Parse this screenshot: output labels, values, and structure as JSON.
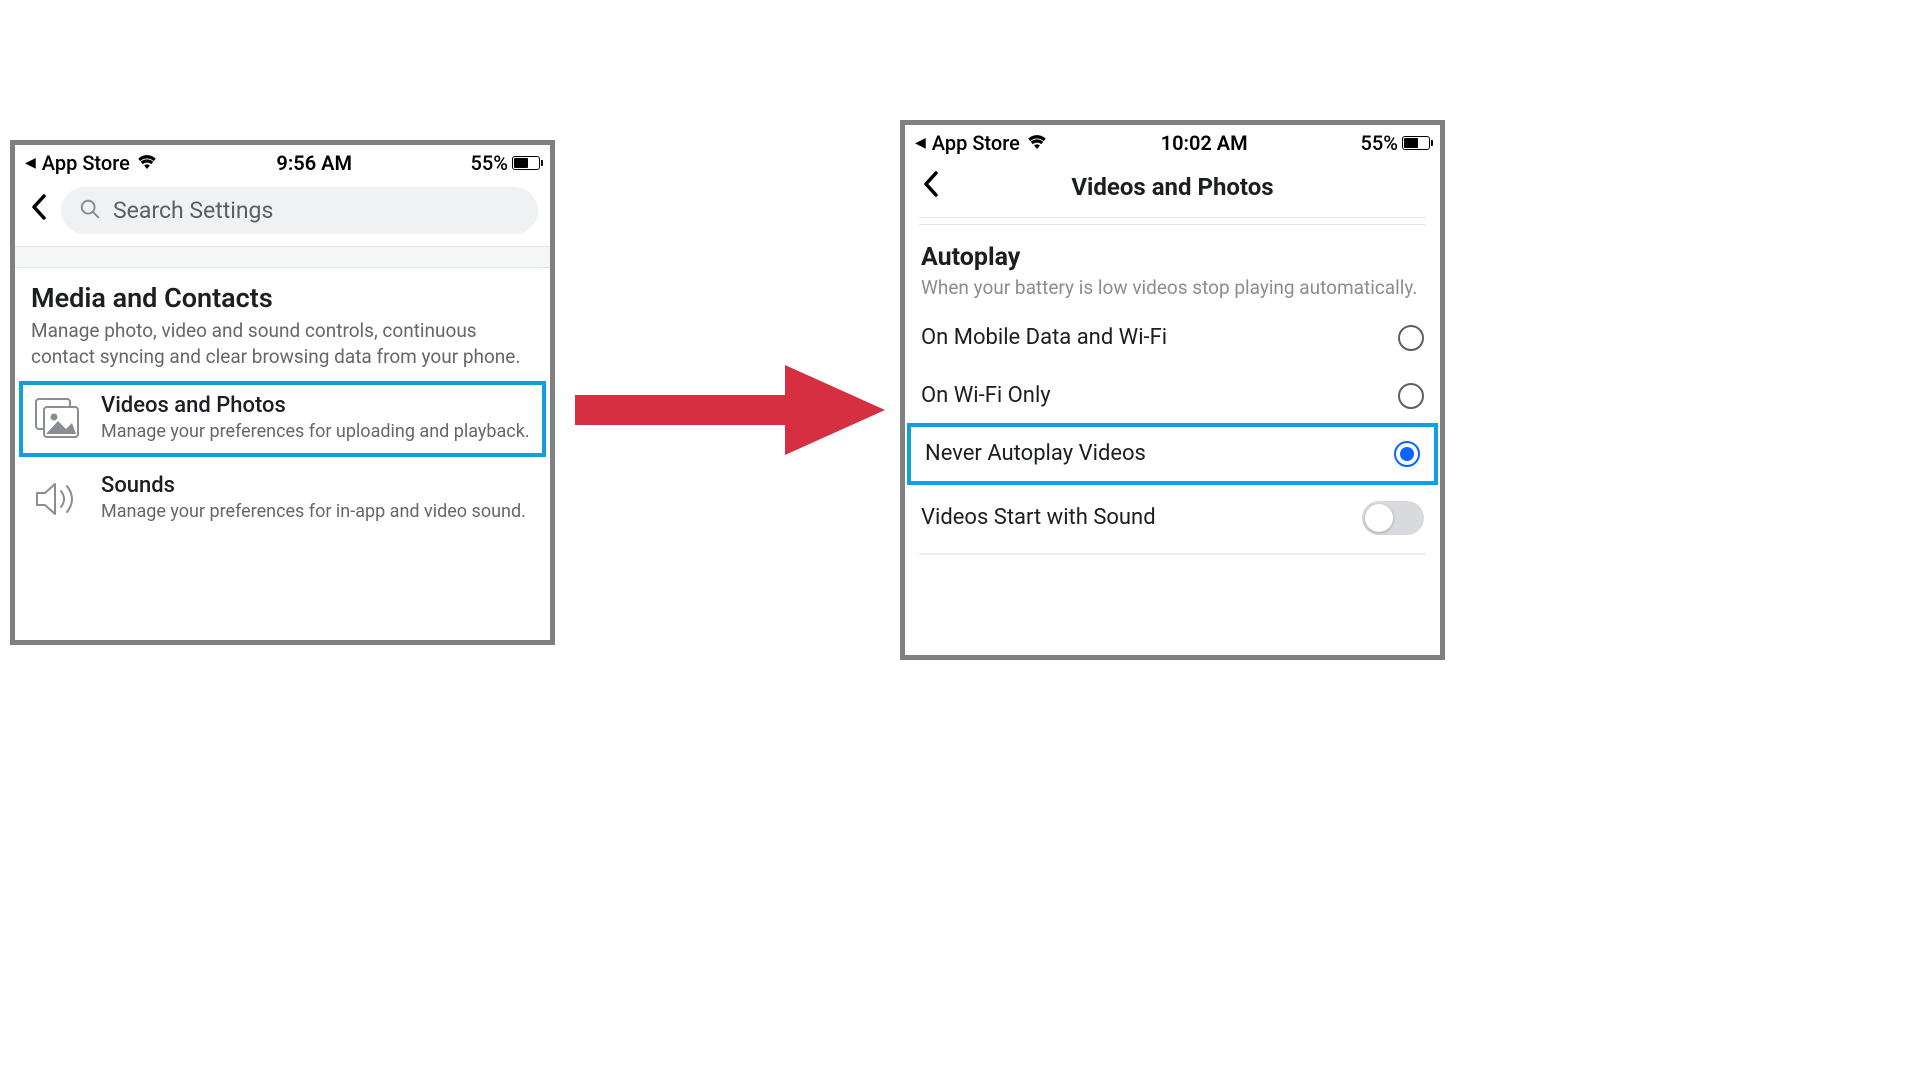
{
  "left": {
    "status": {
      "back_app": "App Store",
      "time": "9:56 AM",
      "battery": "55%"
    },
    "search_placeholder": "Search Settings",
    "section": {
      "title": "Media and Contacts",
      "desc": "Manage photo, video and sound controls, continuous contact syncing and clear browsing data from your phone."
    },
    "items": [
      {
        "title": "Videos and Photos",
        "desc": "Manage your preferences for uploading and playback.",
        "highlighted": true
      },
      {
        "title": "Sounds",
        "desc": "Manage your preferences for in-app and video sound.",
        "highlighted": false
      }
    ]
  },
  "right": {
    "status": {
      "back_app": "App Store",
      "time": "10:02 AM",
      "battery": "55%"
    },
    "page_title": "Videos and Photos",
    "group": {
      "title": "Autoplay",
      "desc": "When your battery is low videos stop playing automatically."
    },
    "options": [
      {
        "label": "On Mobile Data and Wi-Fi",
        "selected": false,
        "highlighted": false
      },
      {
        "label": "On Wi-Fi Only",
        "selected": false,
        "highlighted": false
      },
      {
        "label": "Never Autoplay Videos",
        "selected": true,
        "highlighted": true
      }
    ],
    "toggle": {
      "label": "Videos Start with Sound",
      "on": false
    }
  }
}
